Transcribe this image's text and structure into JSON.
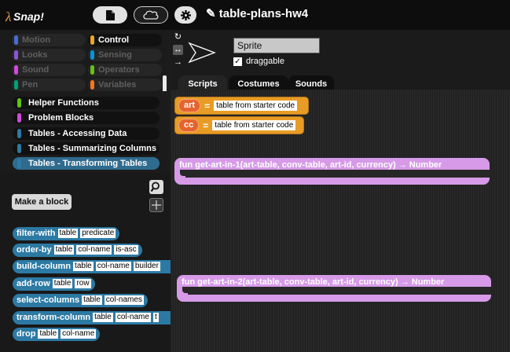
{
  "app": {
    "logo_text": "Snap!",
    "project_title": "table-plans-hw4"
  },
  "toolbar": {
    "file_icon": "file-icon",
    "cloud_icon": "cloud-icon",
    "settings_icon": "gear-icon"
  },
  "categories": [
    {
      "label": "Motion",
      "color": "#4a6cd4",
      "active": false
    },
    {
      "label": "Control",
      "color": "#e6a822",
      "active": true
    },
    {
      "label": "Looks",
      "color": "#8a55d7",
      "active": false
    },
    {
      "label": "Sensing",
      "color": "#0494dc",
      "active": false
    },
    {
      "label": "Sound",
      "color": "#cf4ad9",
      "active": false
    },
    {
      "label": "Operators",
      "color": "#62c213",
      "active": false
    },
    {
      "label": "Pen",
      "color": "#00a178",
      "active": false
    },
    {
      "label": "Variables",
      "color": "#f3761d",
      "active": false
    }
  ],
  "custom_categories": [
    {
      "label": "Helper Functions",
      "color": "#62c213",
      "selected": false
    },
    {
      "label": "Problem Blocks",
      "color": "#cf4ad9",
      "selected": false
    },
    {
      "label": "Tables - Accessing Data",
      "color": "#2c7aa4",
      "selected": false
    },
    {
      "label": "Tables - Summarizing Columns",
      "color": "#2c7aa4",
      "selected": false
    },
    {
      "label": "Tables - Transforming Tables",
      "color": "#2c7aa4",
      "selected": true
    }
  ],
  "palette": {
    "make_block_label": "Make a block",
    "blocks": [
      {
        "name": "filter-with",
        "slots": [
          "table",
          "predicate"
        ]
      },
      {
        "name": "order-by",
        "slots": [
          "table",
          "col-name",
          "is-asc"
        ]
      },
      {
        "name": "build-column",
        "slots": [
          "table",
          "col-name",
          "builder"
        ]
      },
      {
        "name": "add-row",
        "slots": [
          "table",
          "row"
        ]
      },
      {
        "name": "select-columns",
        "slots": [
          "table",
          "col-names"
        ]
      },
      {
        "name": "transform-column",
        "slots": [
          "table",
          "col-name",
          "t"
        ]
      },
      {
        "name": "drop",
        "slots": [
          "table",
          "col-name"
        ]
      }
    ]
  },
  "sprite": {
    "name": "Sprite",
    "draggable_label": "draggable",
    "draggable_checked": true
  },
  "tabs": [
    {
      "label": "Scripts",
      "active": true
    },
    {
      "label": "Costumes",
      "active": false
    },
    {
      "label": "Sounds",
      "active": false
    }
  ],
  "scripts": {
    "assignments": [
      {
        "var": "art",
        "op": "=",
        "value": "table from starter code"
      },
      {
        "var": "cc",
        "op": "=",
        "value": "table from starter code"
      }
    ],
    "functions": [
      {
        "label": "fun get-art-in-1(art-table, conv-table, art-id, currency) → Number"
      },
      {
        "label": "fun get-art-in-2(art-table, conv-table, art-id, currency) → Number"
      }
    ]
  }
}
